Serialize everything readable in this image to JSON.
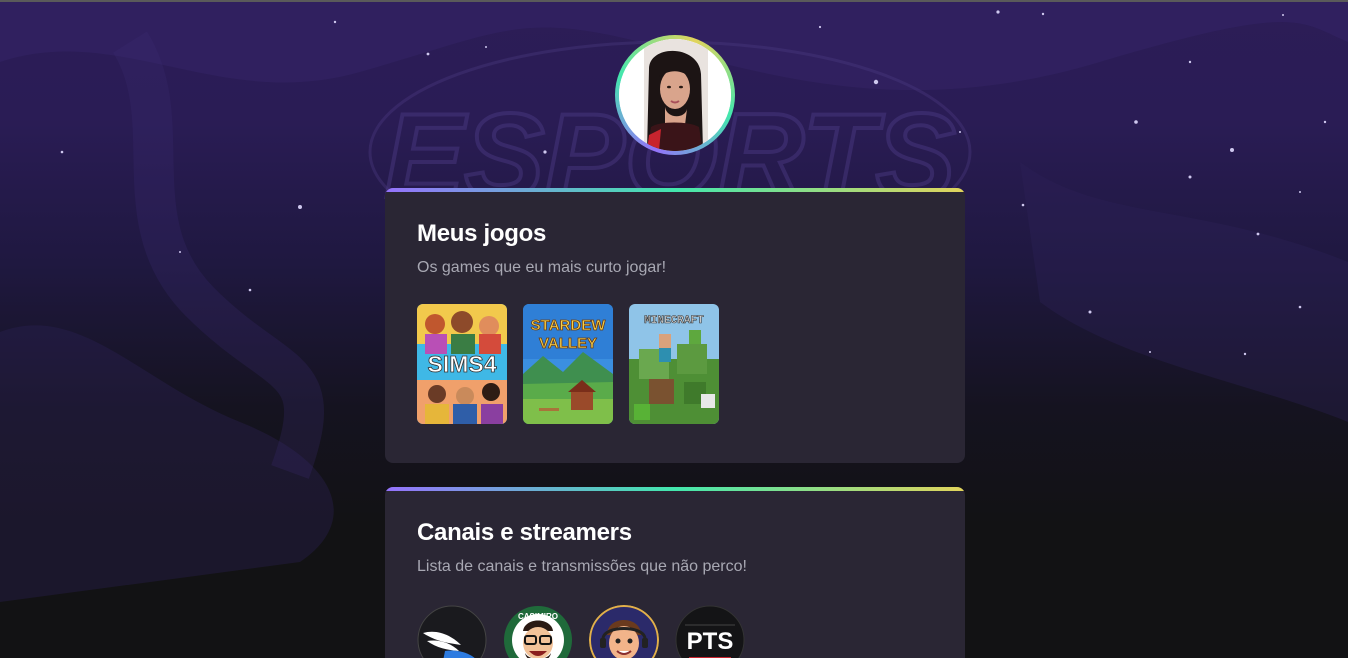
{
  "profile": {
    "avatar_icon": "profile-photo"
  },
  "background": {
    "watermark_text": "ESPORTS"
  },
  "games_section": {
    "title": "Meus jogos",
    "subtitle": "Os games que eu mais curto jogar!",
    "games": [
      {
        "name": "The Sims 4",
        "cover_text": "SIMS4"
      },
      {
        "name": "Stardew Valley",
        "cover_line1": "STARDEW",
        "cover_line2": "VALLEY"
      },
      {
        "name": "Minecraft",
        "cover_text": "MINECRAFT"
      }
    ]
  },
  "streamers_section": {
    "title": "Canais e streamers",
    "subtitle": "Lista de canais e transmissões que não perco!",
    "streamers": [
      {
        "name": "winged-logo"
      },
      {
        "name": "casimiro",
        "ring_text": "CASIMIRO"
      },
      {
        "name": "cartoon-streamer"
      },
      {
        "name": "pts",
        "label": "PTS"
      }
    ]
  },
  "colors": {
    "accent_purple": "#9572fc",
    "accent_green": "#43e7ad",
    "accent_yellow": "#e2d45c",
    "card_bg": "#2a2634",
    "page_bg": "#121214"
  }
}
